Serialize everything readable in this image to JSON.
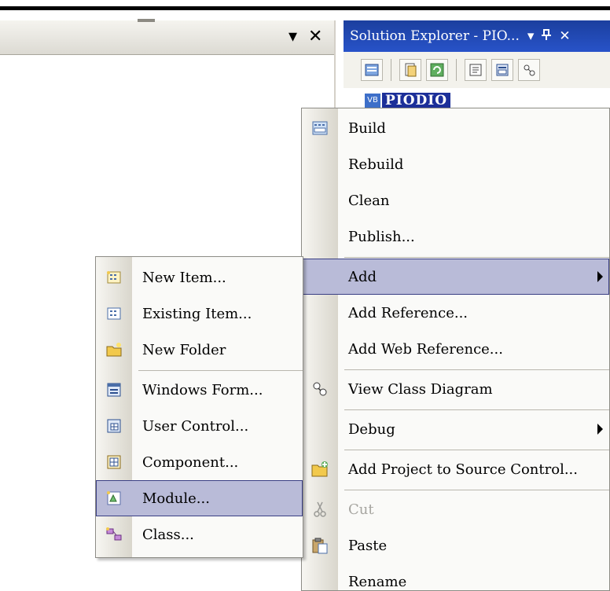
{
  "left_pane": {
    "dropdown_icon": "chevron-down-icon",
    "dropdown_glyph": "▾",
    "close_glyph": "✕"
  },
  "solution_explorer": {
    "title": "Solution Explorer - PIO...",
    "dropdown_glyph": "▾",
    "pin_glyph": "ᵖ",
    "close_glyph": "✕",
    "project_icon_text": "VB",
    "project_name": "PIODIO"
  },
  "context_menu": {
    "items": [
      {
        "label": "Build",
        "icon": "build-icon"
      },
      {
        "label": "Rebuild"
      },
      {
        "label": "Clean"
      },
      {
        "label": "Publish..."
      },
      {
        "label": "Add",
        "submenu": true,
        "highlighted": true
      },
      {
        "label": "Add Reference..."
      },
      {
        "label": "Add Web Reference..."
      },
      {
        "label": "View Class Diagram",
        "icon": "class-diagram-icon"
      },
      {
        "label": "Debug",
        "submenu": true
      },
      {
        "label": "Add Project to Source Control...",
        "icon": "source-control-icon"
      },
      {
        "label": "Cut",
        "icon": "cut-icon",
        "disabled": true
      },
      {
        "label": "Paste",
        "icon": "paste-icon"
      },
      {
        "label": "Rename"
      }
    ]
  },
  "add_submenu": {
    "items": [
      {
        "label": "New Item...",
        "icon": "new-item-icon"
      },
      {
        "label": "Existing Item...",
        "icon": "existing-item-icon"
      },
      {
        "label": "New Folder",
        "icon": "new-folder-icon"
      },
      {
        "label": "Windows Form...",
        "icon": "windows-form-icon"
      },
      {
        "label": "User Control...",
        "icon": "user-control-icon"
      },
      {
        "label": "Component...",
        "icon": "component-icon"
      },
      {
        "label": "Module...",
        "icon": "module-icon",
        "highlighted": true
      },
      {
        "label": "Class...",
        "icon": "class-icon"
      }
    ]
  },
  "colors": {
    "highlight": "#b9bbd8",
    "title_bar": "#2853c9",
    "menu_bg": "#fafaf8"
  }
}
